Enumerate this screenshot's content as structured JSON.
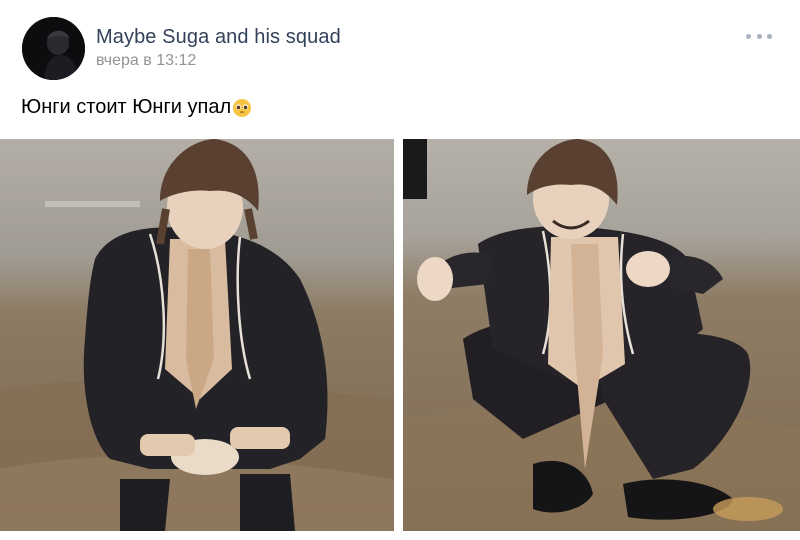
{
  "post": {
    "author": "Maybe Suga and his squad",
    "timestamp": "вчера в 13:12",
    "text": "Юнги стоит Юнги упал",
    "emoji": "pleading-face-emoji",
    "more_icon": "more-horizontal-icon"
  },
  "photos": [
    {
      "subject": "person-crouching"
    },
    {
      "subject": "person-sitting-on-ground"
    }
  ],
  "colors": {
    "author": "#33415a",
    "timestamp": "#939393",
    "text": "#000000",
    "dots": "#aab2bd"
  }
}
